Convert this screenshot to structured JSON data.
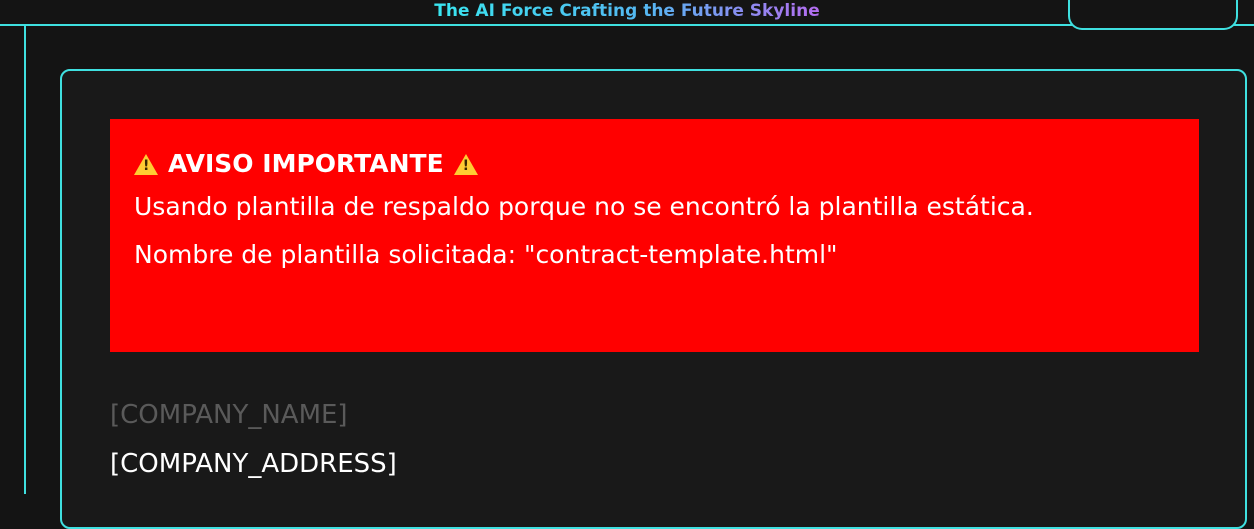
{
  "header": {
    "title": "The AI Force Crafting the Future Skyline"
  },
  "notice": {
    "title": "AVISO IMPORTANTE",
    "message": "Usando plantilla de respaldo porque no se encontró la plantilla estática.",
    "template_line": "Nombre de plantilla solicitada: \"contract-template.html\"",
    "background_color": "#ff0000"
  },
  "document": {
    "company_name": "[COMPANY_NAME]",
    "company_address": "[COMPANY_ADDRESS]"
  },
  "theme": {
    "accent": "#3fe0e0",
    "background": "#141414"
  }
}
